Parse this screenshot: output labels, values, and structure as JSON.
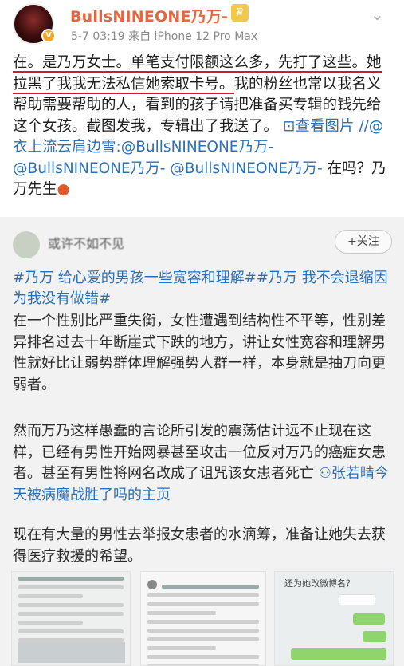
{
  "post": {
    "username": "BullsNINEONE乃万-",
    "meta": "5-7 03:19  来自 iPhone 12 Pro Max",
    "body_underlined": "在。是乃万女士。单笔支付限额这么多，先打了这些。她拉黑了我我无法私信她索取卡号。",
    "body_rest": "我的粉丝也常以我名义帮助需要帮助的人，看到的孩子请把准备买专辑的钱先给这个女孩。截图发我，专辑出了我送了。",
    "view_image": "查看图片",
    "forward_chain": " //@衣上流云肩边雪:@BullsNINEONE乃万- @BullsNINEONE乃万- @BullsNINEONE乃万-",
    "tail": " 在吗？乃万先生"
  },
  "card": {
    "name": "或许不如不见",
    "follow_label": "+关注",
    "tags": "#乃万 给心爱的男孩一些宽容和理解##乃万 我不会退缩因为我没有做错#",
    "para1": "在一个性别比严重失衡，女性遭遇到结构性不平等，性别差异排名过去十年断崖式下跌的地方，讲让女性宽容和理解男性就好比让弱势群体理解强势人群一样，本身就是抽刀向更弱者。",
    "para2": "然而万乃这样愚蠢的言论所引发的震荡估计远不止现在这样，已经有男性开始网暴甚至攻击一位反对万乃的癌症女患者。甚至有男性将网名改成了诅咒该女患者死亡",
    "user_link": "张若晴今天被病魔战胜了吗的主页",
    "para3": "现在有大量的男性去举报女患者的水滴筹，准备让她失去获得医疗救援的希望。"
  },
  "thumbs": {
    "t3_question": "还为她改微博名？"
  },
  "colors": {
    "username": "#e8663d",
    "link": "#2b6fb8",
    "underline": "#c8202a",
    "card_bg": "#f2f2f2"
  }
}
